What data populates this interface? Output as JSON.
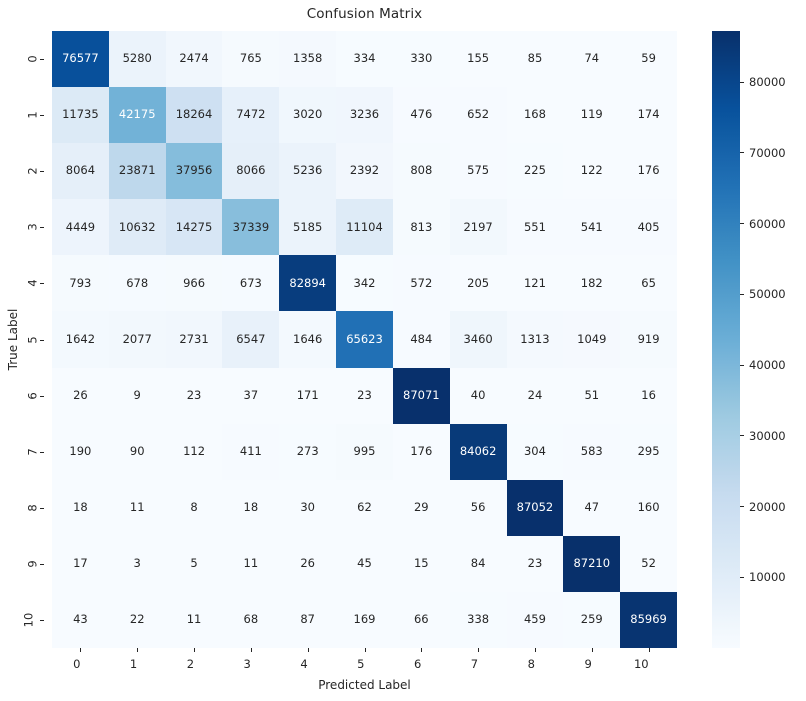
{
  "chart_data": {
    "type": "heatmap",
    "title": "Confusion Matrix",
    "xlabel": "Predicted Label",
    "ylabel": "True Label",
    "colormap": "Blues",
    "grid": false,
    "legend_position": "right-colorbar",
    "annotated": true,
    "x_categories": [
      "0",
      "1",
      "2",
      "3",
      "4",
      "5",
      "6",
      "7",
      "8",
      "9",
      "10"
    ],
    "y_categories": [
      "0",
      "1",
      "2",
      "3",
      "4",
      "5",
      "6",
      "7",
      "8",
      "9",
      "10"
    ],
    "colorbar": {
      "ticks": [
        10000,
        20000,
        30000,
        40000,
        50000,
        60000,
        70000,
        80000
      ],
      "tick_labels": [
        "10000",
        "20000",
        "30000",
        "40000",
        "50000",
        "60000",
        "70000",
        "80000"
      ],
      "vmin": 3,
      "vmax": 87210
    },
    "values": [
      [
        76577,
        5280,
        2474,
        765,
        1358,
        334,
        330,
        155,
        85,
        74,
        59
      ],
      [
        11735,
        42175,
        18264,
        7472,
        3020,
        3236,
        476,
        652,
        168,
        119,
        174
      ],
      [
        8064,
        23871,
        37956,
        8066,
        5236,
        2392,
        808,
        575,
        225,
        122,
        176
      ],
      [
        4449,
        10632,
        14275,
        37339,
        5185,
        11104,
        813,
        2197,
        551,
        541,
        405
      ],
      [
        793,
        678,
        966,
        673,
        82894,
        342,
        572,
        205,
        121,
        182,
        65
      ],
      [
        1642,
        2077,
        2731,
        6547,
        1646,
        65623,
        484,
        3460,
        1313,
        1049,
        919
      ],
      [
        26,
        9,
        23,
        37,
        171,
        23,
        87071,
        40,
        24,
        51,
        16
      ],
      [
        190,
        90,
        112,
        411,
        273,
        995,
        176,
        84062,
        304,
        583,
        295
      ],
      [
        18,
        11,
        8,
        18,
        30,
        62,
        29,
        56,
        87052,
        47,
        160
      ],
      [
        17,
        3,
        5,
        11,
        26,
        45,
        15,
        84,
        23,
        87210,
        52
      ],
      [
        43,
        22,
        11,
        68,
        87,
        169,
        66,
        338,
        459,
        259,
        85969
      ]
    ]
  },
  "colors": {
    "text_dark": "#262626",
    "text_light": "#ffffff",
    "background": "#ffffff",
    "cmap_low": "#f7fbff",
    "cmap_high": "#08306b"
  }
}
